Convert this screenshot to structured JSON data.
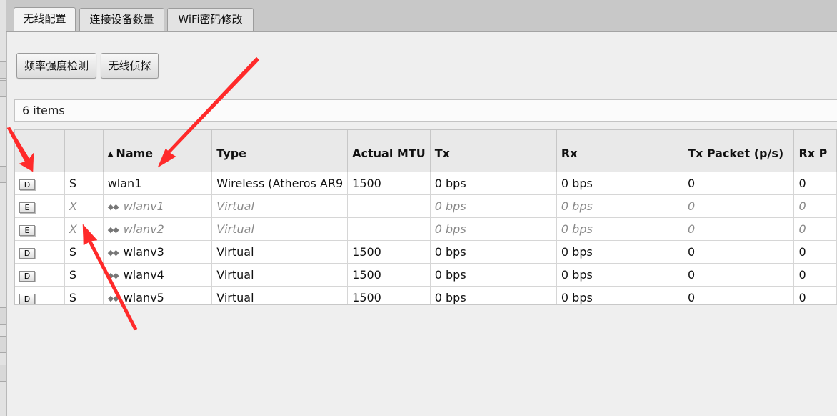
{
  "tabs": [
    {
      "label": "无线配置",
      "active": true
    },
    {
      "label": "连接设备数量",
      "active": false
    },
    {
      "label": "WiFi密码修改",
      "active": false
    }
  ],
  "toolbar": {
    "freq_button": "频率强度检测",
    "sniff_button": "无线侦探"
  },
  "items_count": "6 items",
  "table": {
    "headers": {
      "flag": "",
      "status": "",
      "name": "Name",
      "type": "Type",
      "mtu": "Actual MTU",
      "tx": "Tx",
      "rx": "Rx",
      "txp": "Tx Packet (p/s)",
      "rxp": "Rx P"
    },
    "sort_icon": "sort-ascending-icon",
    "rows": [
      {
        "flag": "D",
        "status": "S",
        "name": "wlan1",
        "type": "Wireless (Atheros AR9",
        "mtu": "1500",
        "tx": "0 bps",
        "rx": "0 bps",
        "txp": "0",
        "rxp": "0"
      },
      {
        "flag": "E",
        "status": "X",
        "name": "wlanv1",
        "type": "Virtual",
        "mtu": "",
        "tx": "0 bps",
        "rx": "0 bps",
        "txp": "0",
        "rxp": "0"
      },
      {
        "flag": "E",
        "status": "X",
        "name": "wlanv2",
        "type": "Virtual",
        "mtu": "",
        "tx": "0 bps",
        "rx": "0 bps",
        "txp": "0",
        "rxp": "0"
      },
      {
        "flag": "D",
        "status": "S",
        "name": "wlanv3",
        "type": "Virtual",
        "mtu": "1500",
        "tx": "0 bps",
        "rx": "0 bps",
        "txp": "0",
        "rxp": "0"
      },
      {
        "flag": "D",
        "status": "S",
        "name": "wlanv4",
        "type": "Virtual",
        "mtu": "1500",
        "tx": "0 bps",
        "rx": "0 bps",
        "txp": "0",
        "rxp": "0"
      },
      {
        "flag": "D",
        "status": "S",
        "name": "wlanv5",
        "type": "Virtual",
        "mtu": "1500",
        "tx": "0 bps",
        "rx": "0 bps",
        "txp": "0",
        "rxp": "0"
      }
    ]
  },
  "colors": {
    "annotation_arrow": "#ff2a2a",
    "disabled_text": "#8a8a8a"
  }
}
